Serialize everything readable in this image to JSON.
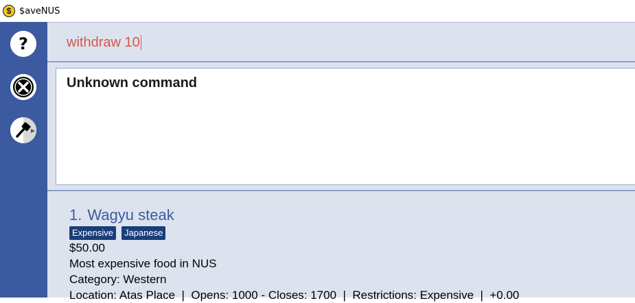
{
  "window": {
    "title": "$aveNUS",
    "icon": "dollar-coin-icon",
    "icon_glyph": "$"
  },
  "sidebar": {
    "items": [
      {
        "name": "help-icon"
      },
      {
        "name": "exit-icon"
      },
      {
        "name": "theme-brush-icon"
      }
    ]
  },
  "command": {
    "value": "withdraw 10"
  },
  "result": {
    "text": "Unknown command"
  },
  "food_list": [
    {
      "index": "1.",
      "name": "Wagyu steak",
      "tags": [
        "Expensive",
        "Japanese"
      ],
      "price": "$50.00",
      "description": "Most expensive food in NUS",
      "category": "Category: Western",
      "details": "Location: Atas Place  |  Opens: 1000 - Closes: 1700  |  Restrictions: Expensive  |  +0.00"
    }
  ],
  "colors": {
    "sidebar": "#3b5aa0",
    "command_text": "#d2574a",
    "tag_bg": "#1a3e7a",
    "title_text": "#3b5aa0"
  }
}
